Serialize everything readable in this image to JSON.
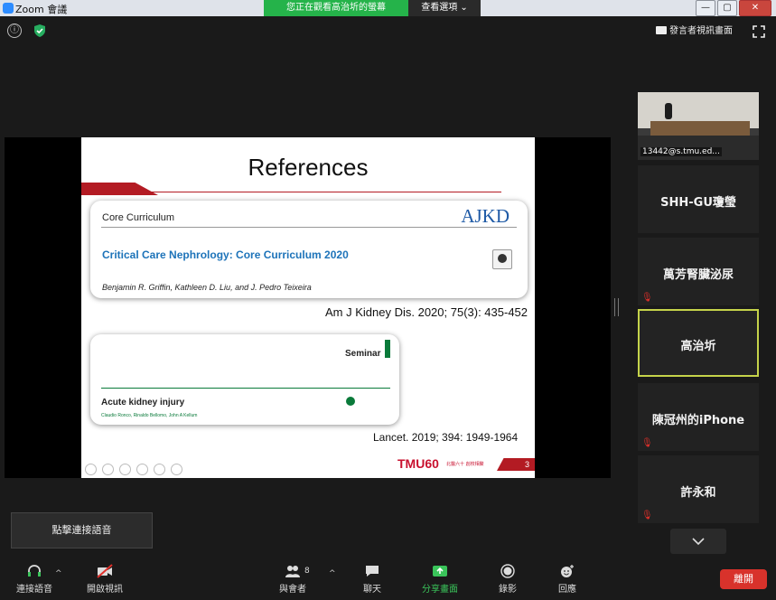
{
  "window": {
    "title": "Zoom 會議",
    "viewing_banner": "您正在觀看高治圻的螢幕",
    "view_options": "查看選項 ⌄",
    "minimize": "—",
    "maximize": "▢",
    "close": "✕"
  },
  "top_bar": {
    "info_icon": "ⓘ",
    "speaker_view": "發言者視訊畫面"
  },
  "slide": {
    "title": "References",
    "ref1": {
      "header": "Core Curriculum",
      "journal": "AJKD",
      "title": "Critical Care Nephrology: Core Curriculum 2020",
      "authors": "Benjamin R. Griffin, Kathleen D. Liu, and J. Pedro Teixeira",
      "citation": "Am J Kidney Dis. 2020; 75(3): 435-452"
    },
    "ref2": {
      "section": "Seminar",
      "title": "Acute kidney injury",
      "authors": "Claudio Ronco, Rinaldo Bellomo, John A Kellum",
      "citation": "Lancet. 2019; 394: 1949-1964"
    },
    "logo": "TMU60",
    "logo_sub": "北醫六十 創校相聚",
    "page_number": "3"
  },
  "participants": [
    {
      "name": "13442@s.tmu.ed...",
      "has_video": true
    },
    {
      "name": "SHH-GU瓊瑩",
      "muted": false
    },
    {
      "name": "萬芳腎臟泌尿",
      "muted": true
    },
    {
      "name": "高治圻",
      "active": true
    },
    {
      "name": "陳冠州的iPhone",
      "muted": true
    },
    {
      "name": "許永和",
      "muted": true
    }
  ],
  "tooltip": "點擊連接語音",
  "toolbar": {
    "join_audio": "連接語音",
    "start_video": "開啟視訊",
    "participants": "與會者",
    "participant_count": "8",
    "chat": "聊天",
    "share_screen": "分享畫面",
    "record": "錄影",
    "reactions": "回應",
    "end": "離開"
  },
  "colors": {
    "accent_green": "#25b34a",
    "active_border": "#c5d34a",
    "end_red": "#d8322b",
    "slide_red": "#b31b23",
    "ajkd_blue": "#1d73b9"
  }
}
